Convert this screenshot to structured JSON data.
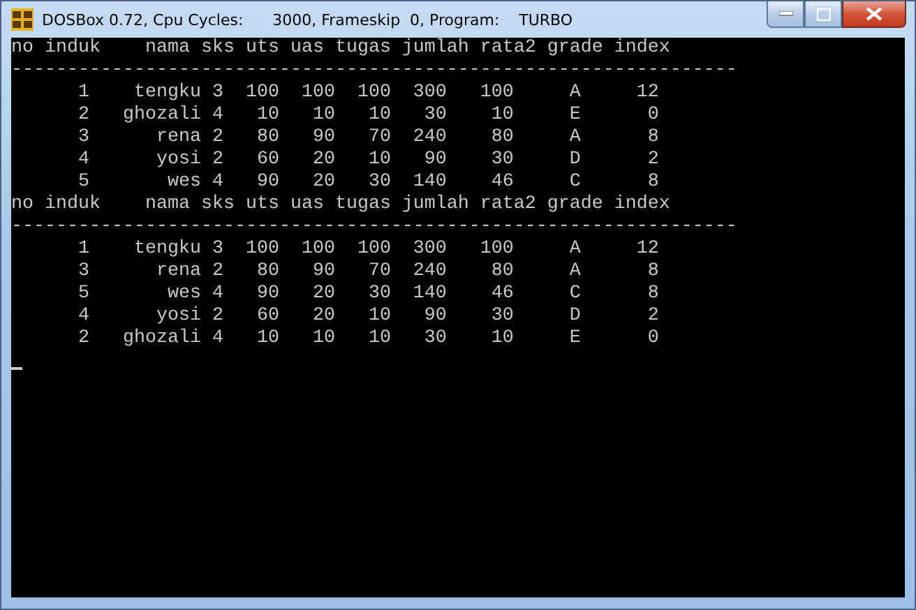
{
  "window": {
    "title": "DOSBox 0.72, Cpu Cycles:      3000, Frameskip  0, Program:    TURBO"
  },
  "console": {
    "lines": [
      "no induk    nama sks uts uas tugas jumlah rata2 grade index",
      "-----------------------------------------------------------------",
      "      1    tengku 3  100  100  100  300   100     A     12",
      "      2   ghozali 4   10   10   10   30    10     E      0",
      "      3      rena 2   80   90   70  240    80     A      8",
      "      4      yosi 2   60   20   10   90    30     D      2",
      "      5       wes 4   90   20   30  140    46     C      8",
      "no induk    nama sks uts uas tugas jumlah rata2 grade index",
      "-----------------------------------------------------------------",
      "      1    tengku 3  100  100  100  300   100     A     12",
      "      3      rena 2   80   90   70  240    80     A      8",
      "      5       wes 4   90   20   30  140    46     C      8",
      "      4      yosi 2   60   20   10   90    30     D      2",
      "      2   ghozali 4   10   10   10   30    10     E      0"
    ],
    "cursor_visible": true
  }
}
